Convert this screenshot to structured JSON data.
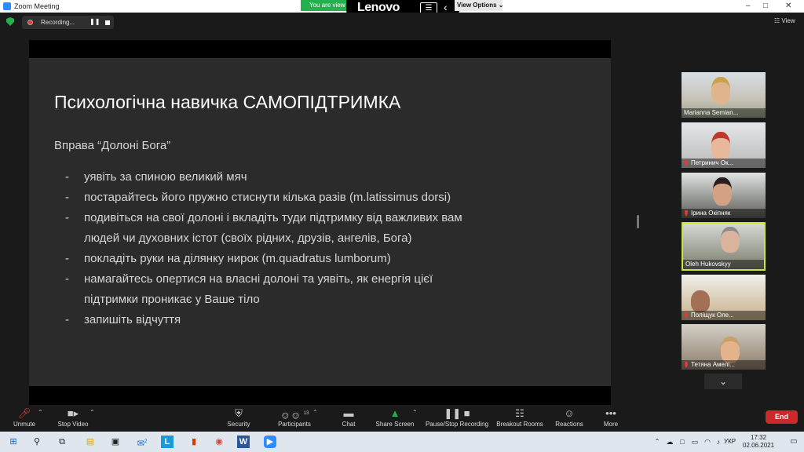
{
  "window": {
    "title": "Zoom Meeting"
  },
  "overlay": {
    "green_banner": "You are view",
    "brand": "Lenovo",
    "view_options": "View Options"
  },
  "topbar": {
    "recording_label": "Recording...",
    "view_label": "View"
  },
  "slide": {
    "title": "Психологічна навичка САМОПІДТРИМКА",
    "subtitle": "Вправа “Долоні Бога”",
    "bullets": [
      {
        "lines": [
          "уявіть за спиною великий мяч"
        ]
      },
      {
        "lines": [
          "постарайтесь його пружно стиснути кілька разів (m.latissimus dorsi)"
        ]
      },
      {
        "lines": [
          "подивіться на свої долоні і вкладіть туди підтримку від важливих вам",
          "людей чи духовних істот (своїх рідних, друзів, ангелів, Бога)"
        ]
      },
      {
        "lines": [
          "покладіть руки на ділянку нирок (m.quadratus lumborum)"
        ]
      },
      {
        "lines": [
          "намагайтесь опертися на власні долоні та уявіть, як енергія цієї",
          "підтримки проникає у Ваше тіло"
        ]
      },
      {
        "lines": [
          "запишіть відчуття"
        ]
      }
    ]
  },
  "participants": [
    {
      "name": "Marianna Semian...",
      "muted": false,
      "active": false
    },
    {
      "name": "Петринич Ок...",
      "muted": true,
      "active": false
    },
    {
      "name": "Ірина Окіпняк",
      "muted": true,
      "active": false
    },
    {
      "name": "Oleh Hukovskyy",
      "muted": false,
      "active": true
    },
    {
      "name": "Поліщук Оле...",
      "muted": true,
      "active": false
    },
    {
      "name": "Тетяна Амелі...",
      "muted": true,
      "active": false
    }
  ],
  "toolbar": {
    "unmute": "Unmute",
    "stop_video": "Stop Video",
    "security": "Security",
    "participants": "Participants",
    "participants_count": "13",
    "chat": "Chat",
    "share_screen": "Share Screen",
    "pause_stop_recording": "Pause/Stop Recording",
    "breakout_rooms": "Breakout Rooms",
    "reactions": "Reactions",
    "more": "More",
    "end": "End"
  },
  "taskbar": {
    "language": "УКР",
    "time": "17:32",
    "date": "02.06.2021",
    "mail_badge": "2"
  },
  "colors": {
    "accent_green": "#23b14d",
    "end_red": "#cc2a2a",
    "active_speaker_border": "#c8e63c",
    "zoom_blue": "#2d8cff"
  }
}
